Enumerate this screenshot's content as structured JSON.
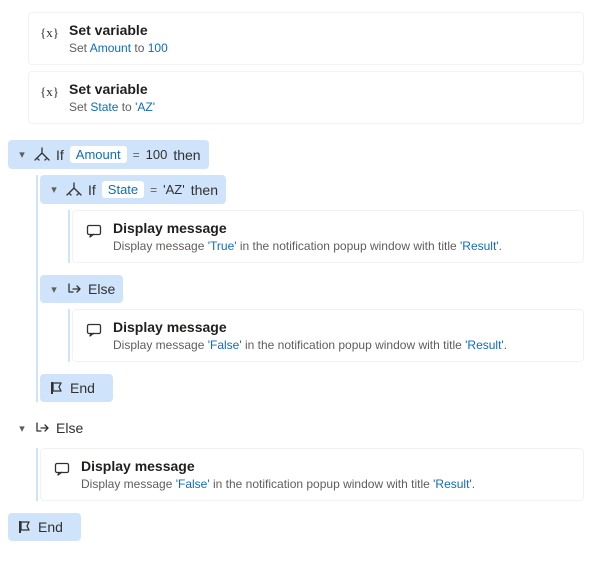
{
  "setvar1": {
    "title": "Set variable",
    "prefix": "Set ",
    "var": "Amount",
    "mid": " to ",
    "val": "100"
  },
  "setvar2": {
    "title": "Set variable",
    "prefix": "Set ",
    "var": "State",
    "mid": " to ",
    "val": "'AZ'"
  },
  "if1": {
    "kw": "If",
    "var": "Amount",
    "op": "=",
    "lit": "100",
    "then": "then"
  },
  "if2": {
    "kw": "If",
    "var": "State",
    "op": "=",
    "lit": "'AZ'",
    "then": "then"
  },
  "msgTrue": {
    "title": "Display message",
    "p1": "Display message ",
    "v1": "'True'",
    "p2": " in the notification popup window with title ",
    "v2": "'Result'",
    "p3": "."
  },
  "msgFalseInner": {
    "title": "Display message",
    "p1": "Display message ",
    "v1": "'False'",
    "p2": " in the notification popup window with title ",
    "v2": "'Result'",
    "p3": "."
  },
  "msgFalseOuter": {
    "title": "Display message",
    "p1": "Display message ",
    "v1": "'False'",
    "p2": " in the notification popup window with title ",
    "v2": "'Result'",
    "p3": "."
  },
  "elseKw": "Else",
  "endKw": "End"
}
